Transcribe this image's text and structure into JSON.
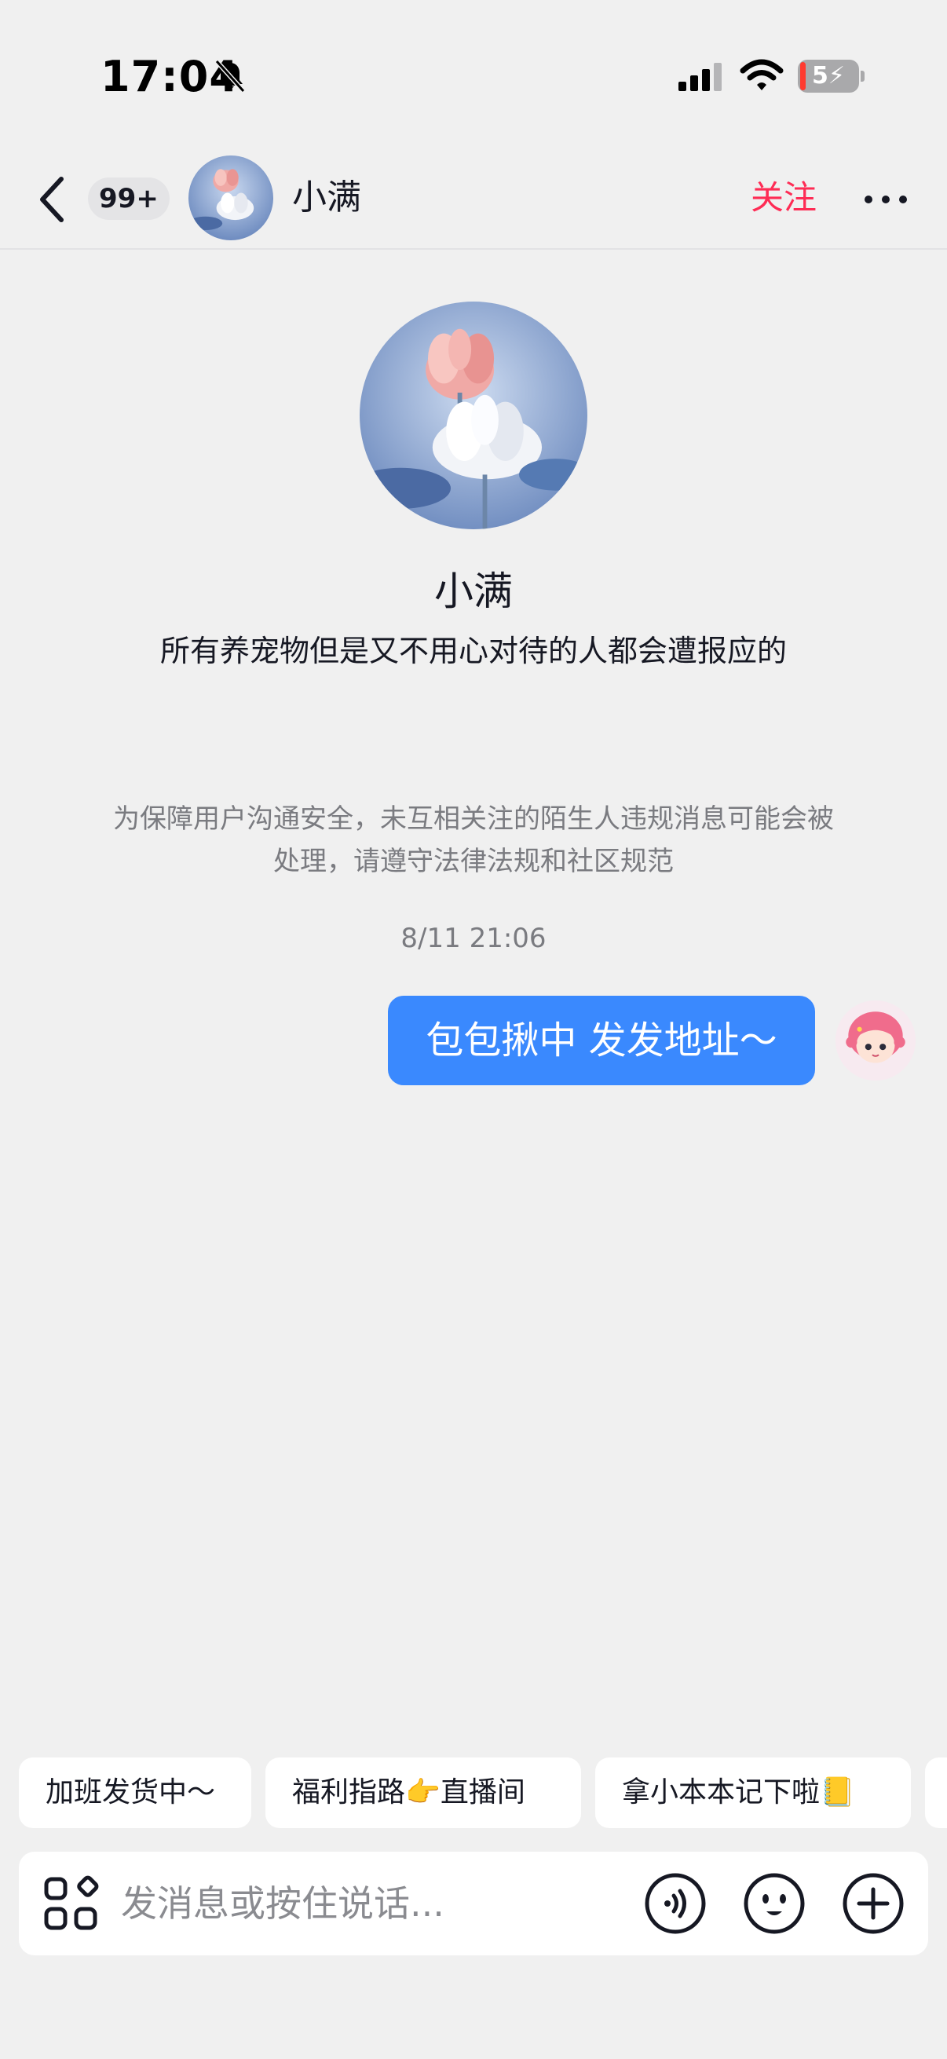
{
  "status_bar": {
    "time": "17:04",
    "battery": "5",
    "icons": [
      "bell-slash-icon",
      "cellular-signal-icon",
      "wifi-icon",
      "battery-charging-icon"
    ]
  },
  "header": {
    "back_icon": "chevron-left-icon",
    "unread_count": "99+",
    "name": "小满",
    "follow_label": "关注",
    "more_icon": "more-horizontal-icon"
  },
  "profile": {
    "name": "小满",
    "bio": "所有养宠物但是又不用心对待的人都会遭报应的"
  },
  "notice": "为保障用户沟通安全，未互相关注的陌生人违规消息可能会被处理，请遵守法律法规和社区规范",
  "messages": [
    {
      "timestamp": "8/11 21:06",
      "text": "包包揪中 发发地址～",
      "from": "me"
    }
  ],
  "quick_replies": [
    {
      "label": "加班发货中～"
    },
    {
      "label": "福利指路👉直播间"
    },
    {
      "label": "拿小本本记下啦📒"
    }
  ],
  "input": {
    "placeholder": "发消息或按住说话...",
    "value": "",
    "icons": [
      "apps-icon",
      "voice-icon",
      "emoji-icon",
      "plus-icon"
    ]
  },
  "colors": {
    "background": "#f0f0f0",
    "bubble": "#3a89fe",
    "follow": "#fe2c55",
    "muted_text": "#7a7b80"
  }
}
